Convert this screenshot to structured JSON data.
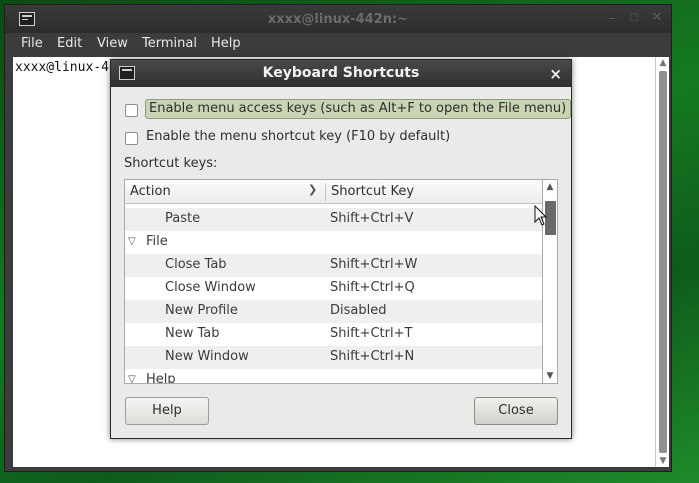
{
  "desktop": {
    "accent": "#157a22"
  },
  "terminal": {
    "title": "xxxx@linux-442n:~",
    "menu": [
      "File",
      "Edit",
      "View",
      "Terminal",
      "Help"
    ],
    "prompt_text": "xxxx@linux-4",
    "icon": "terminal-icon",
    "window_buttons": [
      "minimize-icon",
      "maximize-icon",
      "close-icon"
    ]
  },
  "dialog": {
    "title": "Keyboard Shortcuts",
    "close_glyph": "×",
    "checkbox_menu_access": "Enable menu access keys (such as Alt+F to open the File menu)",
    "checkbox_menu_shortcut": "Enable the menu shortcut key (F10 by default)",
    "shortcut_keys_label": "Shortcut keys:",
    "columns": {
      "action": "Action",
      "shortcut": "Shortcut Key"
    },
    "rows": [
      {
        "type": "item",
        "action": "Paste",
        "shortcut": "Shift+Ctrl+V"
      },
      {
        "type": "group",
        "action": "File",
        "shortcut": ""
      },
      {
        "type": "item",
        "action": "Close Tab",
        "shortcut": "Shift+Ctrl+W"
      },
      {
        "type": "item",
        "action": "Close Window",
        "shortcut": "Shift+Ctrl+Q"
      },
      {
        "type": "item",
        "action": "New Profile",
        "shortcut": "Disabled"
      },
      {
        "type": "item",
        "action": "New Tab",
        "shortcut": "Shift+Ctrl+T"
      },
      {
        "type": "item",
        "action": "New Window",
        "shortcut": "Shift+Ctrl+N"
      },
      {
        "type": "group",
        "action": "Help",
        "shortcut": ""
      }
    ],
    "help_button": "Help",
    "close_button": "Close"
  }
}
